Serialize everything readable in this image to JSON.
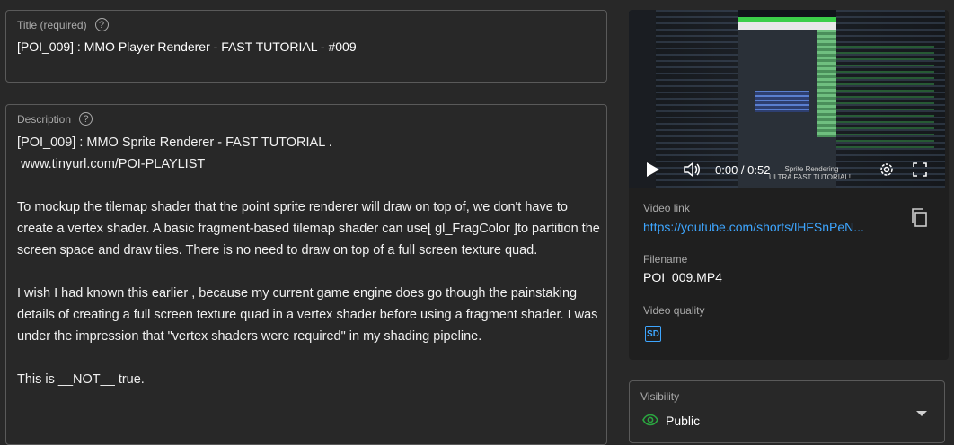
{
  "title_field": {
    "label": "Title (required)",
    "help": "?",
    "value": "[POI_009] : MMO Player Renderer - FAST TUTORIAL - #009"
  },
  "description_field": {
    "label": "Description",
    "help": "?",
    "lines": [
      "[POI_009] : MMO Sprite Renderer - FAST TUTORIAL .",
      " www.tinyurl.com/POI-PLAYLIST",
      "To mockup the tilemap shader that the point sprite renderer will draw on top of, we don't have to create a vertex shader. A basic fragment-based tilemap shader can use[ gl_FragColor ]to partition the screen space and draw tiles. There is no need to draw on top of a full screen texture quad.",
      "I wish I had known this earlier , because my current game engine does go though the painstaking details of creating a full screen texture quad in a vertex shader before using a fragment shader. I was under the impression that \"vertex shaders were required\" in my shading pipeline.",
      "This is __NOT__ true."
    ]
  },
  "video": {
    "time": "0:00 / 0:52",
    "overlay_text_1": "Sprite Rendering",
    "overlay_text_2": "ULTRA FAST TUTORIAL!",
    "video_link_label": "Video link",
    "video_link": "https://youtube.com/shorts/lHFSnPeN...",
    "filename_label": "Filename",
    "filename": "POI_009.MP4",
    "quality_label": "Video quality",
    "quality_badge": "SD"
  },
  "visibility": {
    "label": "Visibility",
    "value": "Public"
  },
  "icons": {
    "play": "play-icon",
    "volume": "volume-icon",
    "settings": "gear-icon",
    "fullscreen": "fullscreen-icon",
    "copy": "copy-icon",
    "eye": "eye-icon",
    "caret": "dropdown-caret-icon"
  },
  "colors": {
    "background": "#282828",
    "link": "#3ea6ff",
    "eye_icon": "#2ba640"
  }
}
